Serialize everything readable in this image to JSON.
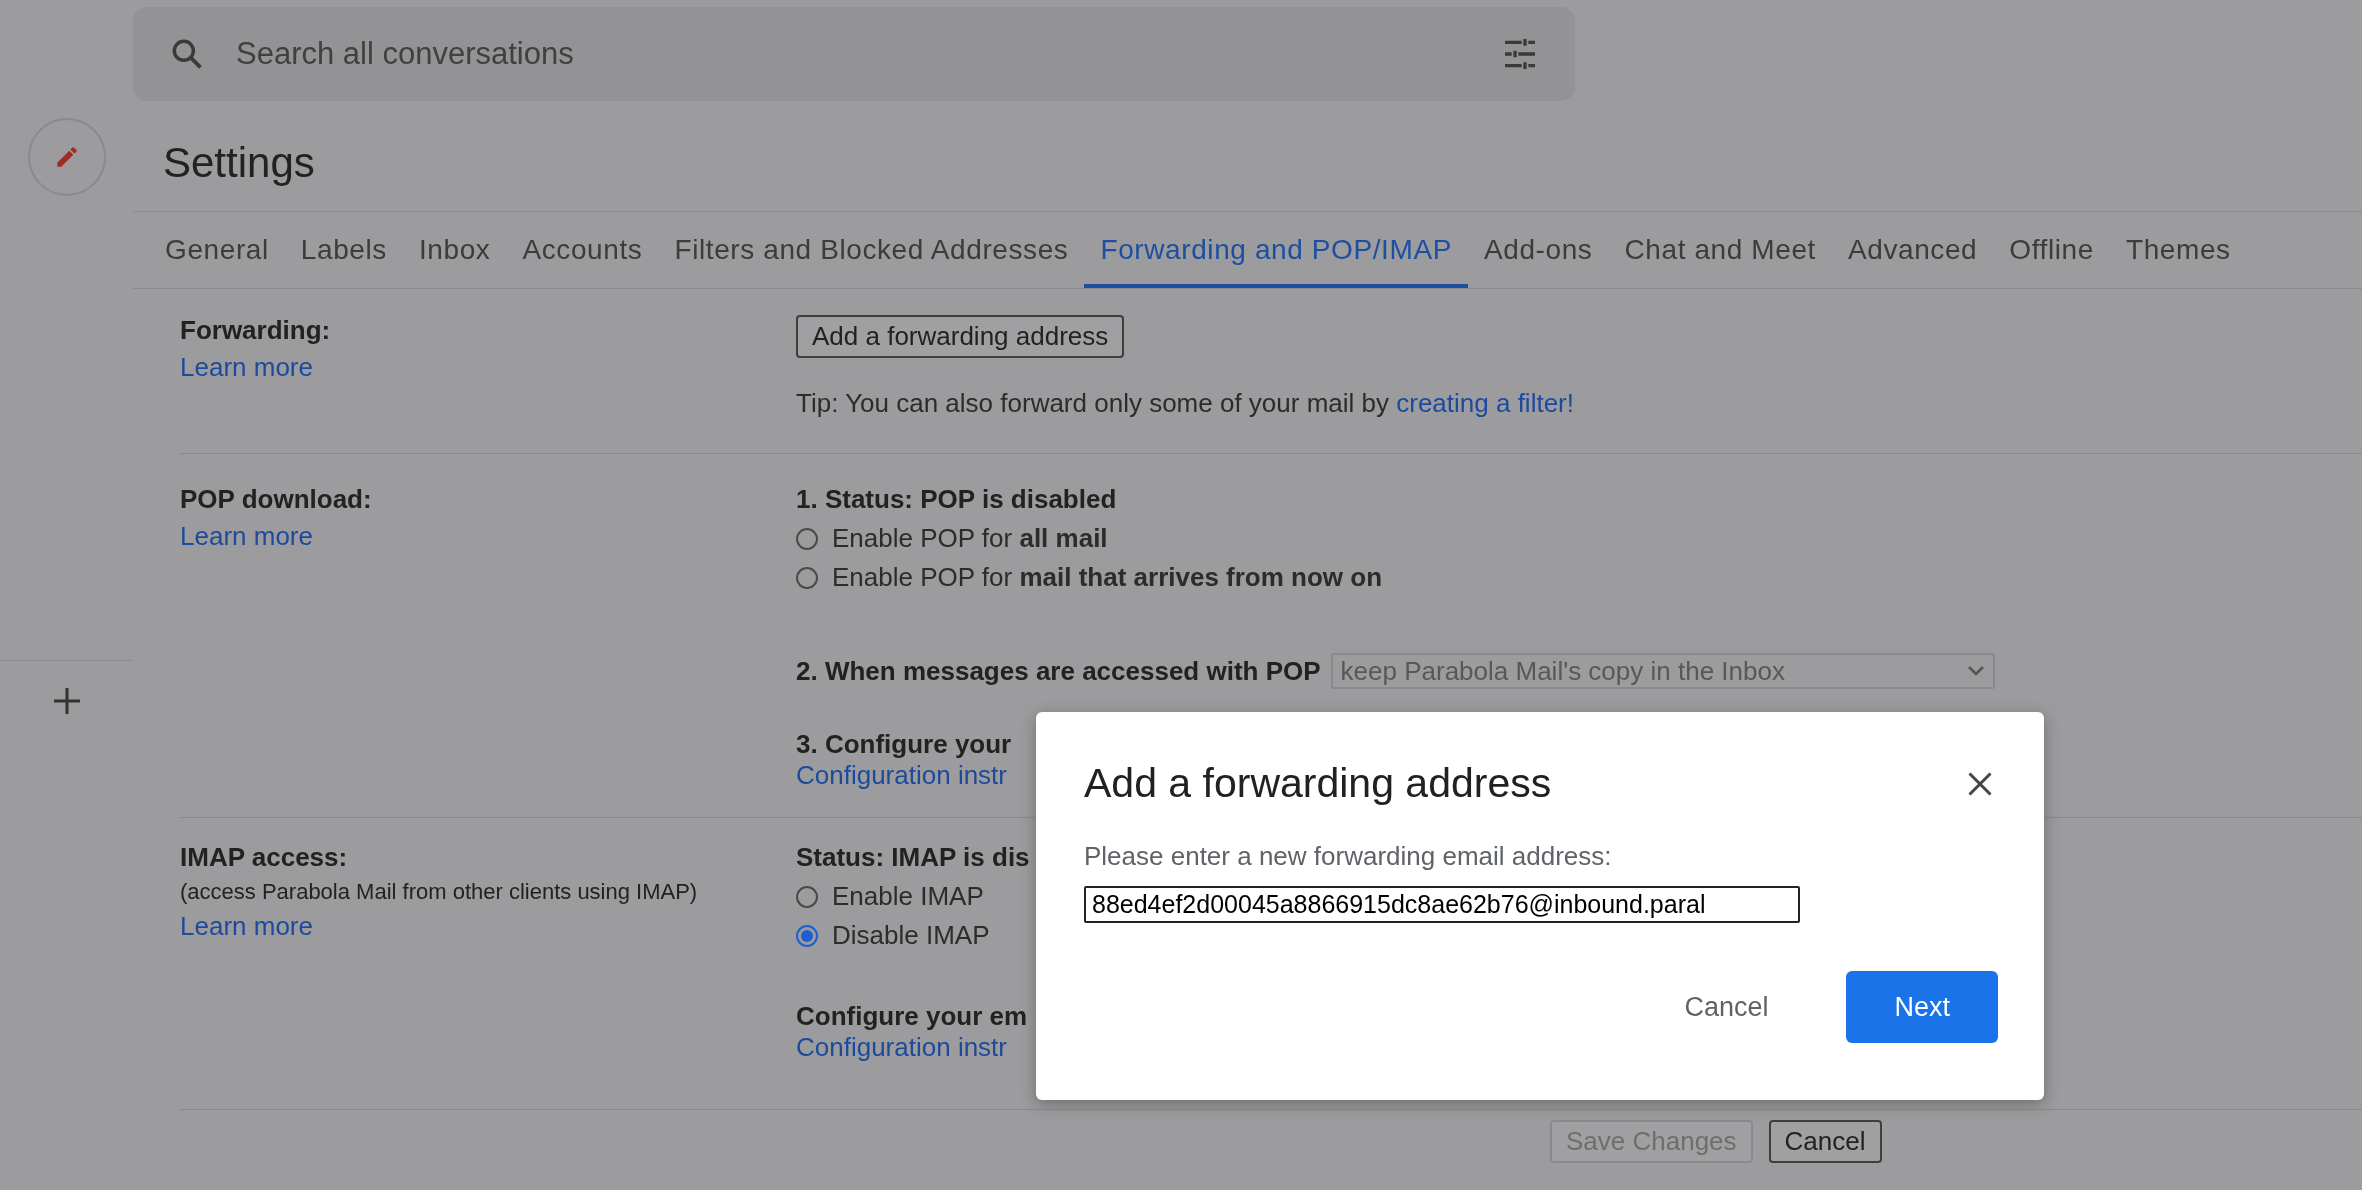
{
  "search": {
    "placeholder": "Search all conversations"
  },
  "title": "Settings",
  "tabs": [
    {
      "label": "General",
      "selected": false
    },
    {
      "label": "Labels",
      "selected": false
    },
    {
      "label": "Inbox",
      "selected": false
    },
    {
      "label": "Accounts",
      "selected": false
    },
    {
      "label": "Filters and Blocked Addresses",
      "selected": false
    },
    {
      "label": "Forwarding and POP/IMAP",
      "selected": true
    },
    {
      "label": "Add-ons",
      "selected": false
    },
    {
      "label": "Chat and Meet",
      "selected": false
    },
    {
      "label": "Advanced",
      "selected": false
    },
    {
      "label": "Offline",
      "selected": false
    },
    {
      "label": "Themes",
      "selected": false
    }
  ],
  "forwarding": {
    "label": "Forwarding:",
    "link": "Learn more",
    "button": "Add a forwarding address",
    "tip": "Tip: You can also forward only some of your mail by",
    "tip_link": "creating a filter!"
  },
  "pop": {
    "label": "POP download:",
    "link": "Learn more",
    "status": "1. Status: POP is disabled",
    "options": [
      {
        "text": "Enable POP for **all mail**",
        "selected": false
      },
      {
        "text": "Enable POP for **mail that arrives from now on**",
        "selected": false
      }
    ],
    "when_label": "2. When messages are accessed with POP",
    "when_select": {
      "value": "keep Parabola Mail's copy in the Inbox",
      "disabled": true
    },
    "configure": "3. Configure your",
    "configure_link": "Configuration instr"
  },
  "imap": {
    "label": "IMAP access:",
    "note": "(access Parabola Mail from other clients using IMAP)",
    "link": "Learn more",
    "status": "Status: IMAP is dis",
    "options": [
      {
        "text": "Enable IMAP",
        "selected": false
      },
      {
        "text": "Disable IMAP",
        "selected": true
      }
    ],
    "configure": "Configure your em",
    "configure_link": "Configuration instr"
  },
  "footer": [
    {
      "label": "Save Changes",
      "disabled": true
    },
    {
      "label": "Cancel",
      "disabled": false
    }
  ],
  "dialog": {
    "title": "Add a forwarding address",
    "prompt": "Please enter a new forwarding email address:",
    "value": "88ed4ef2d00045a8866915dc8ae62b76@inbound.paral",
    "buttons": [
      {
        "label": "Cancel",
        "kind": "text"
      },
      {
        "label": "Next",
        "kind": "primary"
      }
    ]
  }
}
